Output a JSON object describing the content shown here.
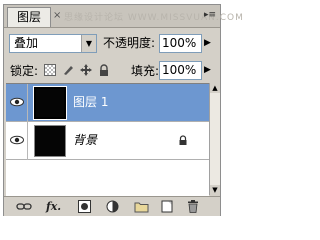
{
  "panel": {
    "tab_label": "图层",
    "tab_close": "×",
    "menu_glyph": "▸≡",
    "watermark": "思缘设计论坛  WWW.MISSVUAN.COM"
  },
  "blend": {
    "mode": "叠加",
    "arrow": "▼"
  },
  "opacity": {
    "label": "不透明度:",
    "value": "100%",
    "arrow": "▶"
  },
  "lock": {
    "label": "锁定:",
    "icons": [
      "lock-transparency-icon",
      "lock-paint-icon",
      "lock-position-icon",
      "lock-all-icon"
    ]
  },
  "fill": {
    "label": "填充:",
    "value": "100%",
    "arrow": "▶"
  },
  "layers": [
    {
      "name": "图层 1",
      "selected": true,
      "visible": true
    },
    {
      "name": "背景",
      "selected": false,
      "visible": true,
      "locked": true
    }
  ],
  "toolbar": {
    "icons": [
      "link-icon",
      "fx-icon",
      "mask-icon",
      "adjustment-icon",
      "group-folder-icon",
      "new-layer-icon",
      "trash-icon"
    ],
    "fx_label": "fx."
  },
  "colors": {
    "selection": "#6d97d0",
    "panel_bg": "#d4d0c8"
  }
}
